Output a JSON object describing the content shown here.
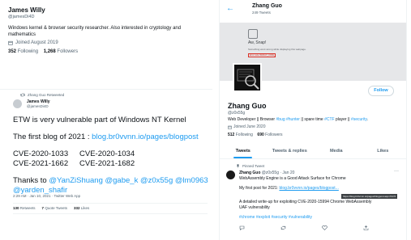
{
  "left_profile": {
    "name": "James Willy",
    "handle": "@jamesDi4D",
    "bio": "Windows kernel & browser security researcher. Also interested in cryptology and mathematics",
    "joined": "Joined August 2019",
    "following_count": "352",
    "following_label": "Following",
    "followers_count": "1,268",
    "followers_label": "Followers"
  },
  "retweet": {
    "retweeted_by": "Zhang Guo Retweeted",
    "author_name": "James Willy",
    "author_handle": "@jamesDi4D",
    "line1": "ETW is very vulnerable part of Windows NT Kernel",
    "line2_prefix": "The first blog of 2021 : ",
    "line2_link": "blog.br0vvnn.io/pages/blogpost",
    "cves": [
      "CVE-2020-1033",
      "CVE-2020-1034",
      "CVE-2021-1662",
      "CVE-2021-1682"
    ],
    "thanks_prefix": "Thanks to ",
    "thanks_mentions": "@YanZiShuang @gabe_k @z0x55g @lm0963",
    "thanks_mentions2": "@yarden_shafir",
    "timestamp": "2:29 AM · Jan 10, 2021 · Twitter Web App",
    "retweets_count": "130",
    "retweets_label": "Retweets",
    "quotes_count": "7",
    "quotes_label": "Quote Tweets",
    "likes_count": "332",
    "likes_label": "Likes"
  },
  "right_profile": {
    "header_name": "Zhang Guo",
    "header_tweets": "249 Tweets",
    "banner_title": "Aw, Snap!",
    "banner_text": "Something went wrong while displaying this webpage.",
    "banner_error": "Error code: RESULT_CODE_KILLED",
    "follow_button": "Follow",
    "name": "Zhang Guo",
    "handle": "@z0x55g",
    "bio_prefix": "Web Developer || Browser ",
    "bio_tag1": "#bug",
    "bio_tag2": " #hunter",
    "bio_mid": " || spare time ",
    "bio_tag3": "#CTF",
    "bio_mid2": " player || ",
    "bio_tag4": "#security",
    "bio_end": ".",
    "joined": "Joined June 2020",
    "following_count": "512",
    "following_label": "Following",
    "followers_count": "690",
    "followers_label": "Followers",
    "tabs": [
      "Tweets",
      "Tweets & replies",
      "Media",
      "Likes"
    ],
    "pinned_label": "Pinned Tweet",
    "tweet_name": "Zhang Guo",
    "tweet_meta": " @z0x55g · Jan 20",
    "tweet_more": "···",
    "tweet_subject": "WebAssembly Engine is a Good Attack Surface for Chrome",
    "tweet_first_prefix": "My first post for 2021: ",
    "tweet_first_link": "blog.br0vvnn.io/pages/blogpost...",
    "tooltip": "https://blog.br0vvnn.io/pages/blogpost.aspx?id=5",
    "tweet_detail": "A detailed write-up for exploiting CVE-2020-15994 Chrome WebAssembly UAF vulnerability",
    "tweet_tags": "#chrome #exploit #security #vulnerability"
  },
  "colors": {
    "accent": "#1d9bf0",
    "text": "#0f1419",
    "muted": "#536471",
    "banner": "#e6e7e9"
  },
  "icons": [
    "retweet-icon",
    "calendar-icon",
    "pin-icon",
    "back-arrow-icon",
    "reply-icon",
    "like-icon",
    "share-icon",
    "sad-tab-icon"
  ]
}
